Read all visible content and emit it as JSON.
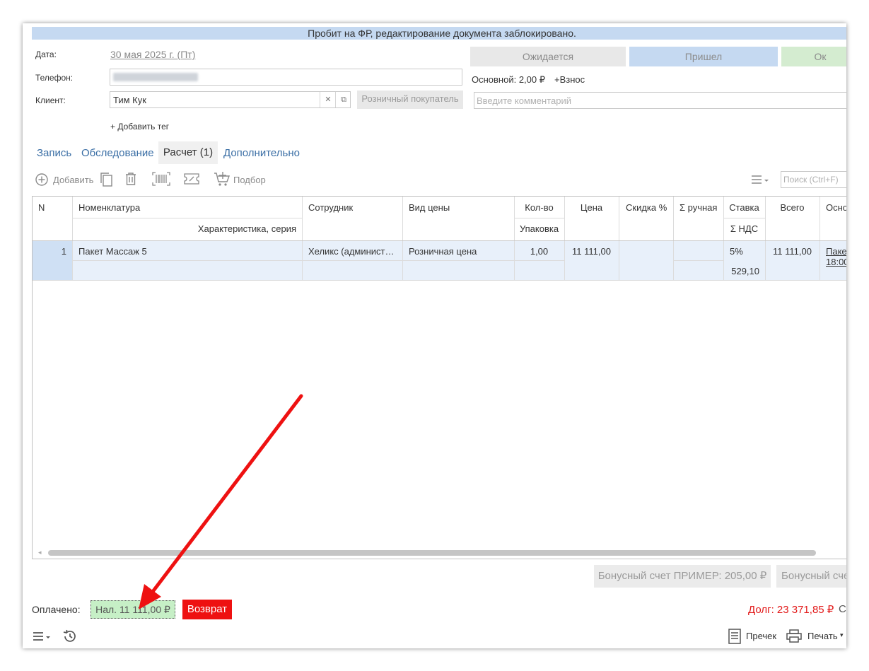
{
  "banner": "Пробит на ФР, редактирование документа заблокировано.",
  "form": {
    "date_label": "Дата:",
    "date_value": "30 мая 2025 г. (Пт)",
    "phone_label": "Телефон:",
    "client_label": "Клиент:",
    "client_value": "Тим Кук",
    "retail_button": "Розничный покупатель",
    "add_tag": "+ Добавить тег",
    "comment_placeholder": "Введите комментарий"
  },
  "status": {
    "waiting": "Ожидается",
    "arrived": "Пришел",
    "ok": "Ок",
    "main_price": "Основной: 2,00 ₽",
    "fee": "+Взнос"
  },
  "tabs": [
    "Запись",
    "Обследование",
    "Расчет (1)",
    "Дополнительно"
  ],
  "toolbar": {
    "add": "Добавить",
    "pick": "Подбор",
    "search_placeholder": "Поиск (Ctrl+F)"
  },
  "table": {
    "headers": {
      "n": "N",
      "item": "Номенклатура",
      "characteristic": "Характеристика, серия",
      "employee": "Сотрудник",
      "price_type": "Вид цены",
      "qty": "Кол-во",
      "package": "Упаковка",
      "price": "Цена",
      "discount": "Скидка %",
      "manual": "Σ ручная",
      "rate": "Ставка",
      "vat": "Σ НДС",
      "total": "Всего",
      "basis": "Осно"
    },
    "rows": [
      {
        "n": "1",
        "item": "Пакет Массаж 5",
        "employee": "Хеликс (админист…",
        "price_type": "Розничная цена",
        "qty": "1,00",
        "price": "11 111,00",
        "rate": "5%",
        "vat": "529,10",
        "total": "11 111,00",
        "basis_line1": "Паке",
        "basis_line2": "18:00"
      }
    ]
  },
  "bonus": {
    "account1": "Бонусный счет ПРИМЕР: 205,00 ₽",
    "account2": "Бонусный сче"
  },
  "footer": {
    "paid_label": "Оплачено:",
    "paid_value": "Нал. 11 111,00 ₽",
    "return_button": "Возврат",
    "debt": "Долг: 23 371,85 ₽",
    "debt_suffix": "С",
    "receipt": "Пречек",
    "print": "Печать"
  },
  "colors": {
    "banner": "#c5d9f1",
    "arrived": "#c5d9f1",
    "ok": "#d4ecd0",
    "paid": "#c6efc6",
    "return": "#ee1111",
    "debt": "#e21a1a",
    "arrow": "#ee1111"
  }
}
